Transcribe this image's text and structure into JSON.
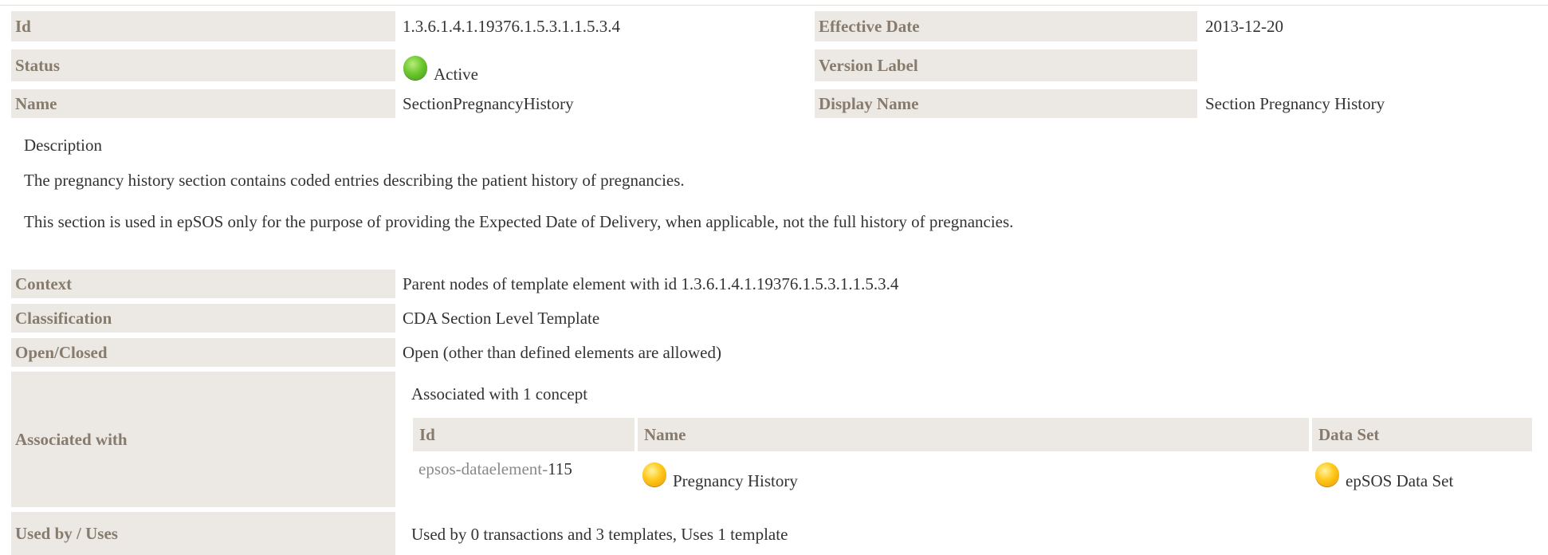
{
  "header_rows": [
    {
      "label_left": "Id",
      "value_left": "1.3.6.1.4.1.19376.1.5.3.1.1.5.3.4",
      "label_right": "Effective Date",
      "value_right": "2013-12-20"
    },
    {
      "label_left": "Status",
      "value_left": "Active",
      "label_right": "Version Label",
      "value_right": ""
    },
    {
      "label_left": "Name",
      "value_left": "SectionPregnancyHistory",
      "label_right": "Display Name",
      "value_right": "Section Pregnancy History"
    }
  ],
  "status_color": "#5cb82a",
  "description": {
    "label": "Description",
    "p1": "The pregnancy history section contains coded entries describing the patient history of pregnancies.",
    "p2": "This section is used in epSOS only for the purpose of providing the Expected Date of Delivery, when applicable, not the full history of pregnancies."
  },
  "details": {
    "context_label": "Context",
    "context_value": "Parent nodes of template element with id 1.3.6.1.4.1.19376.1.5.3.1.1.5.3.4",
    "classification_label": "Classification",
    "classification_value": "CDA Section Level Template",
    "open_closed_label": "Open/Closed",
    "open_closed_value": "Open (other than defined elements are allowed)",
    "associated_label": "Associated with",
    "associated_summary": "Associated with 1 concept",
    "assoc_table": {
      "col_id": "Id",
      "col_name": "Name",
      "col_dataset": "Data Set",
      "row": {
        "id_prefix": "epsos-dataelement-",
        "id_num": "115",
        "name": "Pregnancy History",
        "dataset": "epSOS Data Set"
      }
    },
    "usedby_label": "Used by / Uses",
    "usedby_value": "Used by 0 transactions and 3 templates, Uses 1 template"
  },
  "concept_status_color": "#ffc819"
}
